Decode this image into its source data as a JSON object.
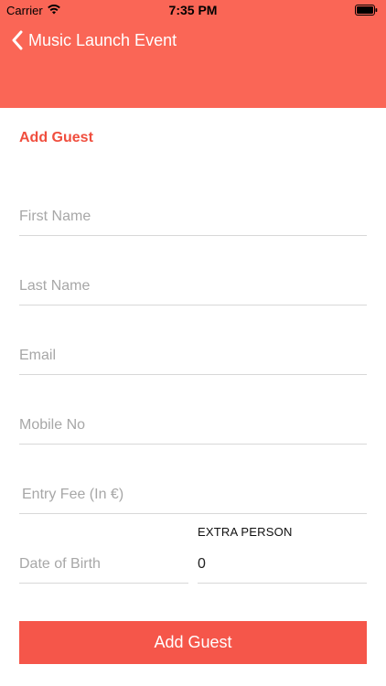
{
  "status_bar": {
    "carrier": "Carrier",
    "time": "7:35 PM",
    "wifi_icon": "wifi-icon",
    "battery_icon": "battery-icon"
  },
  "nav": {
    "back_icon": "chevron-left-icon",
    "title": "Music Launch Event"
  },
  "form": {
    "section_title": "Add Guest",
    "first_name": {
      "placeholder": "First Name",
      "value": ""
    },
    "last_name": {
      "placeholder": "Last Name",
      "value": ""
    },
    "email": {
      "placeholder": "Email",
      "value": ""
    },
    "mobile": {
      "placeholder": "Mobile No",
      "value": ""
    },
    "entry_fee": {
      "placeholder": "Entry Fee (In €)",
      "value": ""
    },
    "dob": {
      "placeholder": "Date of Birth",
      "value": ""
    },
    "extra_person": {
      "label": "EXTRA PERSON",
      "value": "0"
    },
    "submit_label": "Add Guest"
  },
  "colors": {
    "header": "#fa6656",
    "accent": "#f04e3e",
    "button": "#f5564a"
  }
}
